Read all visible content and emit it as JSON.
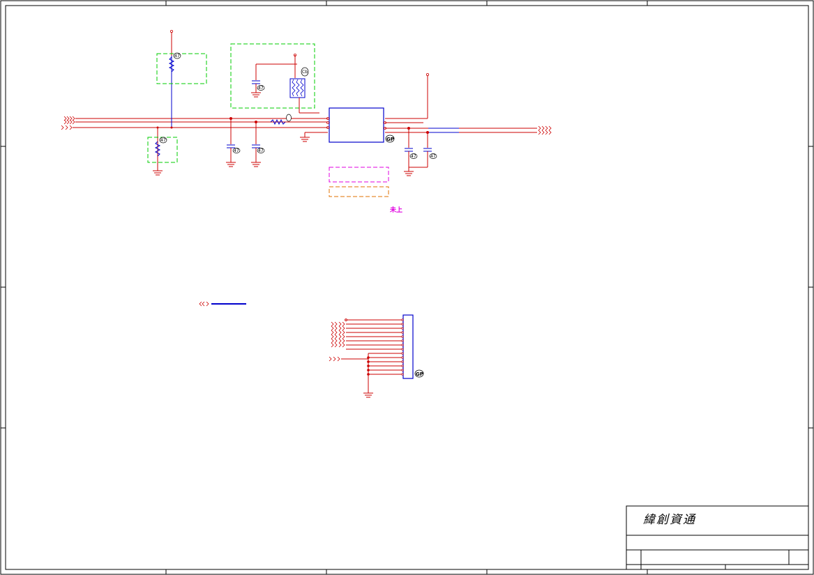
{
  "title_block": {
    "company": "緯創資通"
  },
  "notes": {
    "magenta_note": "未上"
  },
  "part_badges": {
    "gp_label": "GP",
    "cap_label": "47",
    "res_label": "R1",
    "fb_label": "Cb"
  },
  "colors": {
    "wire_red": "#cc0000",
    "wire_blue": "#0000cc",
    "magenta": "#e000e0",
    "green_box": "#00cc00",
    "orange_box": "#e07000",
    "frame": "#000000"
  }
}
